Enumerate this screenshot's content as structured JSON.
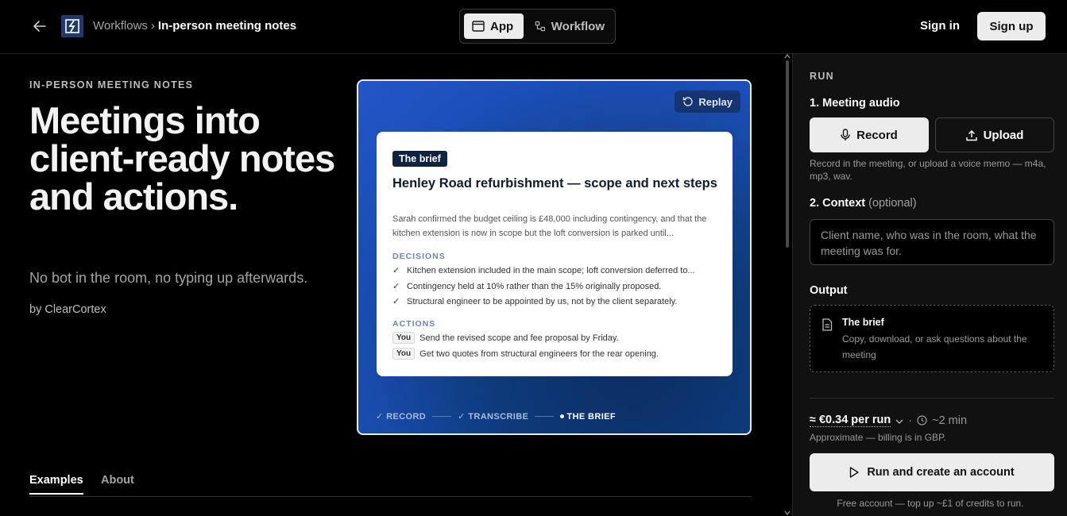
{
  "header": {
    "breadcrumb_root": "Workflows",
    "breadcrumb_sep": "›",
    "breadcrumb_current": "In-person meeting notes",
    "view_toggle": {
      "app_label": "App",
      "workflow_label": "Workflow",
      "selected": "App"
    },
    "sign_in_label": "Sign in",
    "sign_up_label": "Sign up"
  },
  "hero": {
    "eyebrow": "IN-PERSON MEETING NOTES",
    "title": "Meetings into client-ready notes and actions.",
    "subtitle": "No bot in the room, no typing up afterwards.",
    "byline": "by ClearCortex"
  },
  "preview": {
    "replay_label": "Replay",
    "badge": "The brief",
    "title": "Henley Road refurbishment — scope and next steps",
    "summary": "Sarah confirmed the budget ceiling is £48,000 including contingency, and that the kitchen extension is now in scope but the loft conversion is parked until...",
    "decisions_heading": "DECISIONS",
    "decisions": [
      "Kitchen extension included in the main scope; loft conversion deferred to...",
      "Contingency held at 10% rather than the 15% originally proposed.",
      "Structural engineer to be appointed by us, not by the client separately."
    ],
    "actions_heading": "ACTIONS",
    "actions": [
      {
        "owner": "You",
        "text": "Send the revised scope and fee proposal by Friday."
      },
      {
        "owner": "You",
        "text": "Get two quotes from structural engineers for the rear opening."
      }
    ],
    "steps": [
      {
        "label": "RECORD",
        "state": "done"
      },
      {
        "label": "TRANSCRIBE",
        "state": "done"
      },
      {
        "label": "THE BRIEF",
        "state": "active"
      }
    ]
  },
  "tabs": [
    {
      "label": "Examples",
      "active": true
    },
    {
      "label": "About",
      "active": false
    }
  ],
  "panel": {
    "run_label": "RUN",
    "audio_heading": "1. Meeting audio",
    "record_label": "Record",
    "upload_label": "Upload",
    "audio_help": "Record in the meeting, or upload a voice memo — m4a, mp3, wav.",
    "context_heading": "2. Context",
    "context_optional": "(optional)",
    "context_placeholder": "Client name, who was in the room, what the meeting was for.",
    "output_heading": "Output",
    "output_title": "The brief",
    "output_desc": "Copy, download, or ask questions about the meeting",
    "price": "≈ €0.34 per run",
    "duration": "~2 min",
    "dot_sep": "·",
    "approx_note": "Approximate — billing is in GBP.",
    "run_button": "Run and create an account",
    "free_note": "Free account — top up ~£1 of credits to run."
  },
  "colors": {
    "background": "#000000",
    "panel_bg": "#111111",
    "accent_blue": "#1b4fb8",
    "badge_navy": "#0f2340"
  }
}
